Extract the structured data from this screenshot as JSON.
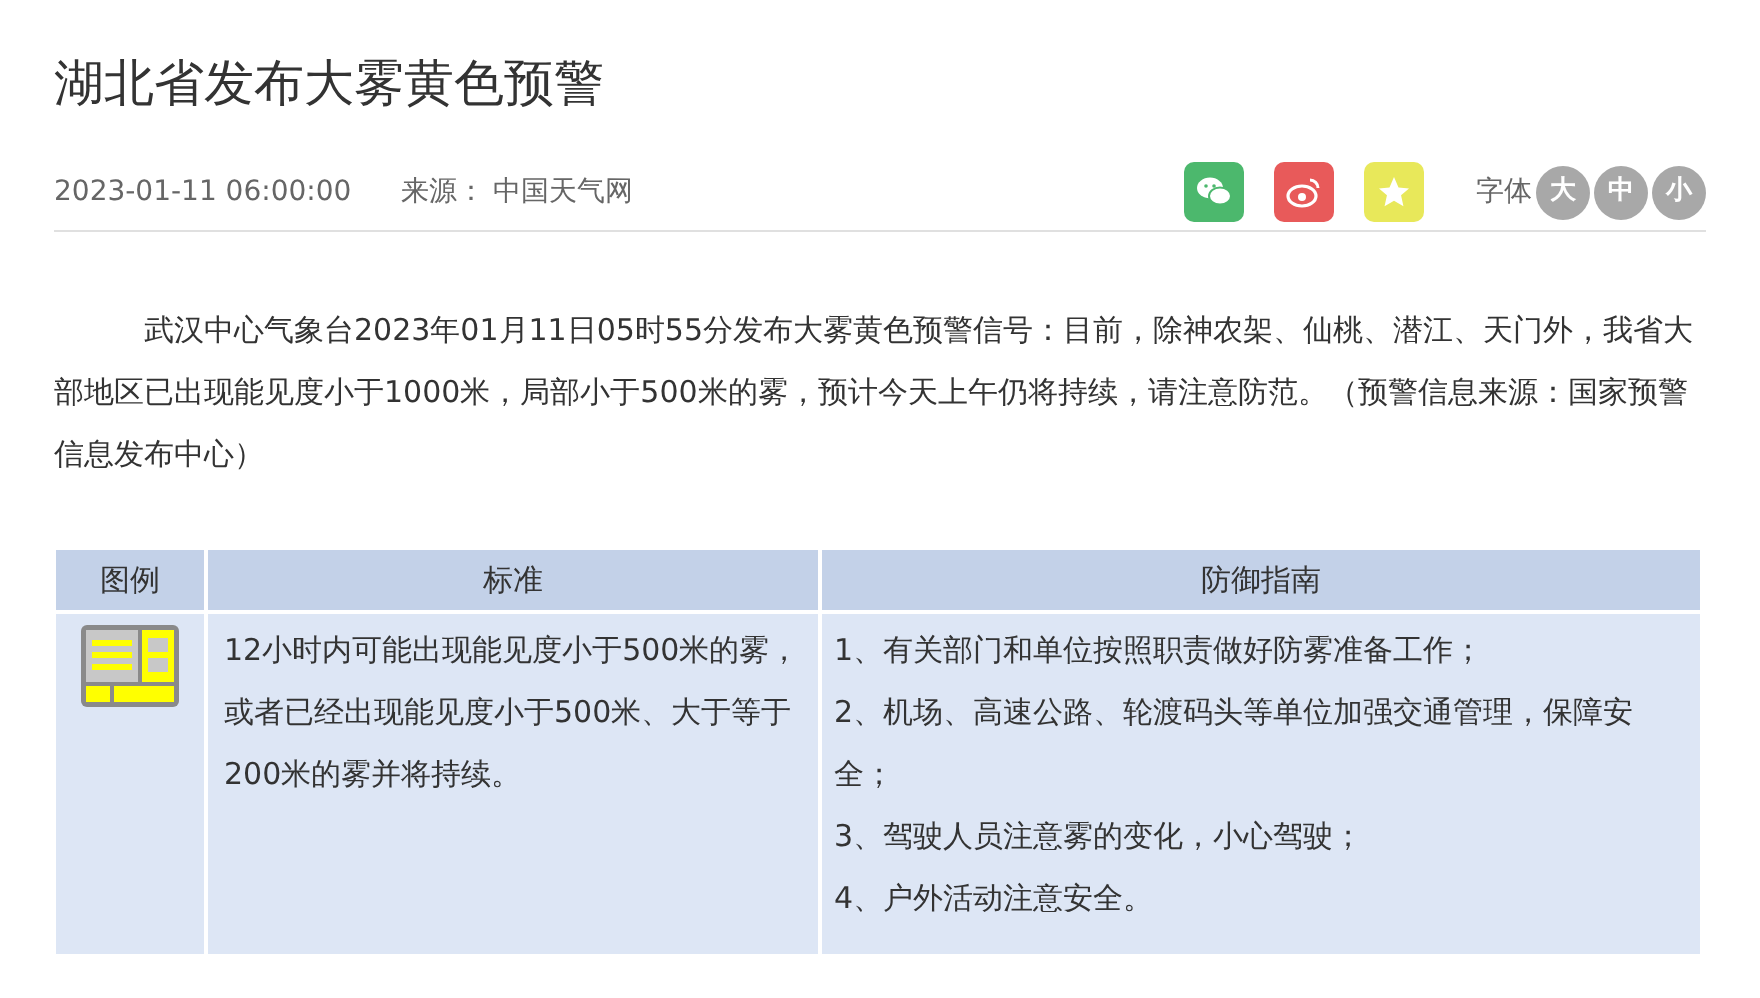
{
  "title": "湖北省发布大雾黄色预警",
  "meta": {
    "date": "2023-01-11 06:00:00",
    "source_label": "来源：",
    "source": "中国天气网"
  },
  "share": [
    {
      "kind": "wechat",
      "color": "#4cb86d"
    },
    {
      "kind": "weibo",
      "color": "#e85a5a"
    },
    {
      "kind": "favorite",
      "color": "#e8e85a"
    }
  ],
  "font_size": {
    "label": "字体",
    "options": [
      {
        "label": "大"
      },
      {
        "label": "中"
      },
      {
        "label": "小"
      }
    ]
  },
  "body": "武汉中心气象台2023年01月11日05时55分发布大雾黄色预警信号：目前，除神农架、仙桃、潜江、天门外，我省大部地区已出现能见度小于1000米，局部小于500米的雾，预计今天上午仍将持续，请注意防范。（预警信息来源：国家预警信息发布中心）",
  "table": {
    "columns": [
      "图例",
      "标准",
      "防御指南"
    ],
    "rows": [
      {
        "standard": "12小时内可能出现能见度小于500米的雾，或者已经出现能见度小于500米、大于等于200米的雾并将持续。",
        "guide": [
          "1、有关部门和单位按照职责做好防雾准备工作；",
          "2、机场、高速公路、轮渡码头等单位加强交通管理，保障安全；",
          "3、驾驶人员注意雾的变化，小心驾驶；",
          "4、户外活动注意安全。"
        ]
      }
    ]
  }
}
